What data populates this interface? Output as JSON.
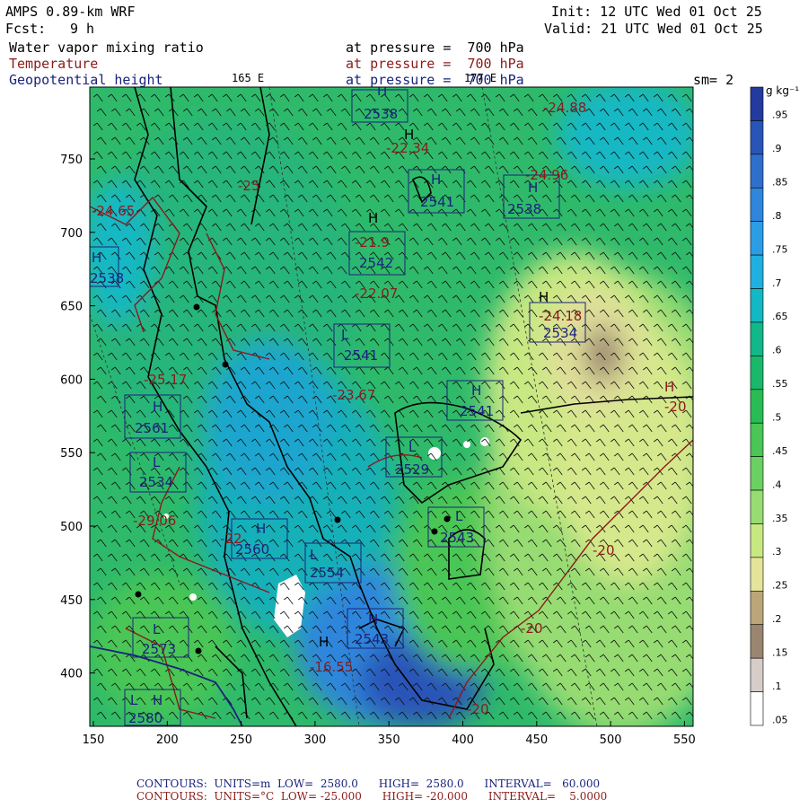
{
  "header": {
    "model": "AMPS 0.89-km WRF",
    "fcst_label": "Fcst:",
    "fcst_value": "9 h",
    "init": "Init: 12 UTC Wed 01 Oct 25",
    "valid": "Valid: 21 UTC Wed 01 Oct 25",
    "field1": "Water vapor mixing ratio",
    "field2": "Temperature",
    "field3": "Geopotential height",
    "pressure1": "at pressure =  700 hPa",
    "pressure2": "at pressure =  700 hPa",
    "pressure3": "at pressure =  700 hPa",
    "lon165": "165 E",
    "lon177": "177 E",
    "smoothing": "sm= 2"
  },
  "colorbar": {
    "units": "g kg⁻¹",
    "levels": [
      ".95",
      ".9",
      ".85",
      ".8",
      ".75",
      ".7",
      ".65",
      ".6",
      ".55",
      ".5",
      ".45",
      ".4",
      ".35",
      ".3",
      ".25",
      ".2",
      ".15",
      ".1",
      ".05"
    ],
    "colors": [
      "#233a9e",
      "#2a55b8",
      "#2f6fcc",
      "#2f86dc",
      "#2b9de6",
      "#1fb0e0",
      "#13b8c4",
      "#10b88a",
      "#1ab86a",
      "#29bc55",
      "#49c655",
      "#6ad062",
      "#96dc72",
      "#c8e882",
      "#e4e49a",
      "#bba67a",
      "#9a8670",
      "#d6ccc8",
      "#ffffff"
    ]
  },
  "axes": {
    "x_ticks": [
      "150",
      "200",
      "250",
      "300",
      "350",
      "400",
      "450",
      "500",
      "550"
    ],
    "y_ticks": [
      "750",
      "700",
      "650",
      "600",
      "550",
      "500",
      "450",
      "400"
    ]
  },
  "labels": {
    "H_marks": [
      "H",
      "H",
      "H",
      "H",
      "H",
      "H",
      "H",
      "H",
      "H",
      "H",
      "H",
      "H",
      "H",
      "H"
    ],
    "L_marks": [
      "L",
      "L",
      "L",
      "L",
      "L",
      "L",
      "L"
    ],
    "heights": [
      "2538",
      "2541",
      "2538",
      "2542",
      "2534",
      "2541",
      "2541",
      "2561",
      "2534",
      "2529",
      "2543",
      "2560",
      "2554",
      "2543",
      "2573",
      "2580",
      "2538"
    ],
    "temps": [
      "-24.88",
      "-22.34",
      "-24.96",
      "-21.9",
      "-22.07",
      "-24.18",
      "-23.67",
      "-25.17",
      "-29.06",
      "-24.65",
      "-25",
      "-22",
      "-20",
      "-20",
      "-20",
      "-20",
      "-20",
      "-16.55"
    ]
  },
  "footer": {
    "line1": "CONTOURS:  UNITS=m  LOW=  2580.0      HIGH=  2580.0      INTERVAL=   60.000",
    "line2": "CONTOURS:  UNITS=°C  LOW= -25.000      HIGH= -20.000      INTERVAL=    5.0000"
  },
  "colors": {
    "height_contour": "#1a237e",
    "temp_contour": "#8b1a1a",
    "coast": "#000000"
  }
}
